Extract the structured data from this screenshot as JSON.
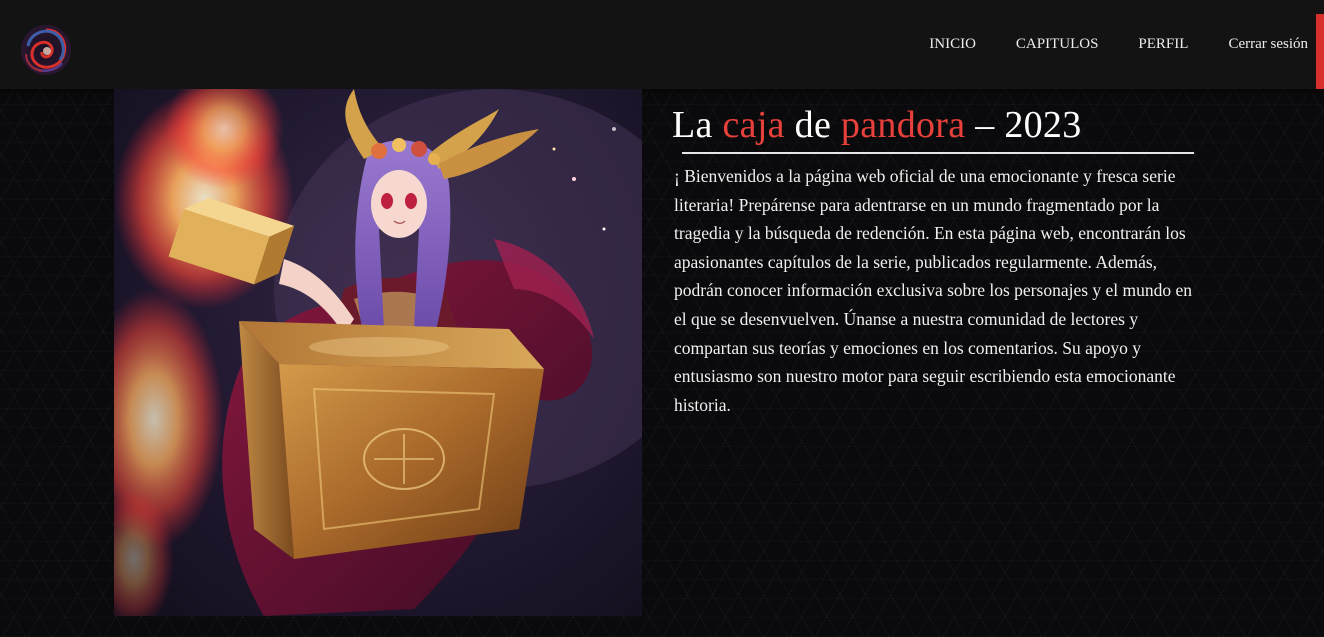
{
  "nav": {
    "logo_icon": "swirl-logo-icon",
    "links": [
      "INICIO",
      "CAPITULOS",
      "PERFIL",
      "Cerrar sesión"
    ]
  },
  "colors": {
    "accent": "#e8403a",
    "navbar": "#131313",
    "background": "#0a0a0c",
    "text": "#f0f0f0"
  },
  "hero": {
    "image_subject": "anime-girl-with-golden-pandora-box"
  },
  "title": {
    "part1": "La ",
    "accent1": "caja",
    "part2": " de ",
    "accent2": "pandora",
    "part3": " – 2023"
  },
  "description": " ¡ Bienvenidos a la página web oficial de una emocionante y fresca serie literaria! Prepárense para adentrarse en un mundo fragmentado por la tragedia y la búsqueda de redención. En esta página web, encontrarán los apasionantes capítulos de la serie, publicados regularmente. Además, podrán conocer información exclusiva sobre los personajes y el mundo en el que se desenvuelven. Únanse a nuestra comunidad de lectores y compartan sus teorías y emociones en los comentarios. Su apoyo y entusiasmo son nuestro motor para seguir escribiendo esta emocionante historia."
}
